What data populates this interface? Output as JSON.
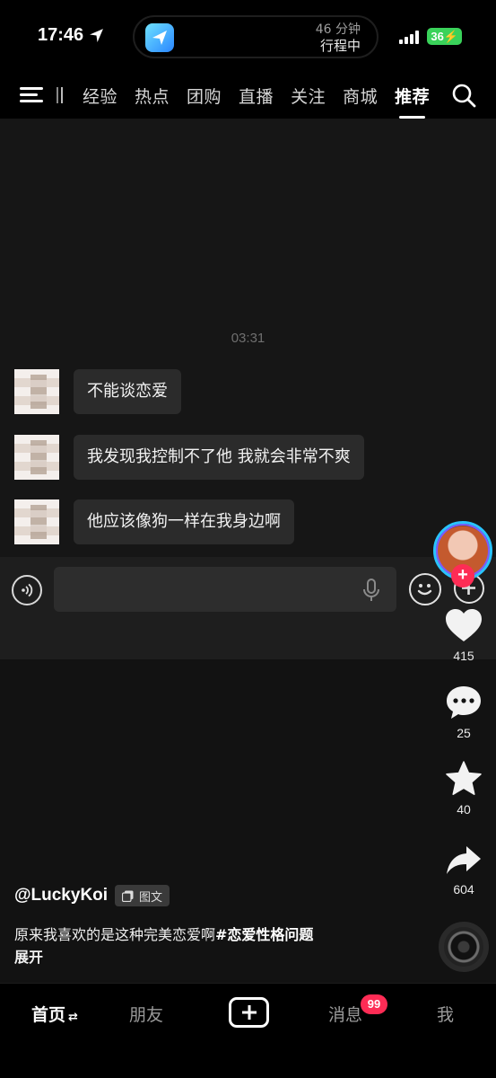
{
  "status_bar": {
    "time": "17:46",
    "island_minutes": "46 分钟",
    "island_status": "行程中",
    "battery": "36"
  },
  "top_nav": {
    "tabs": [
      "经验",
      "热点",
      "团购",
      "直播",
      "关注",
      "商城",
      "推荐"
    ],
    "active_tab": "推荐"
  },
  "chat": {
    "time": "03:31",
    "messages": [
      "不能谈恋爱",
      "我发现我控制不了他 我就会非常不爽",
      "他应该像狗一样在我身边啊"
    ]
  },
  "actions": {
    "likes": "415",
    "comments": "25",
    "favorites": "40",
    "shares": "604"
  },
  "post": {
    "author": "@LuckyKoi",
    "type_label": "图文",
    "caption_text": "原来我喜欢的是这种完美恋爱啊",
    "caption_tag": "#恋爱性格问题",
    "expand": "展开"
  },
  "bottom_nav": {
    "home": "首页",
    "friends": "朋友",
    "messages": "消息",
    "messages_badge": "99",
    "me": "我"
  },
  "colors": {
    "accent_red": "#fe2c55",
    "battery_green": "#3ad25a",
    "avatar_ring": "#29c3ff"
  }
}
